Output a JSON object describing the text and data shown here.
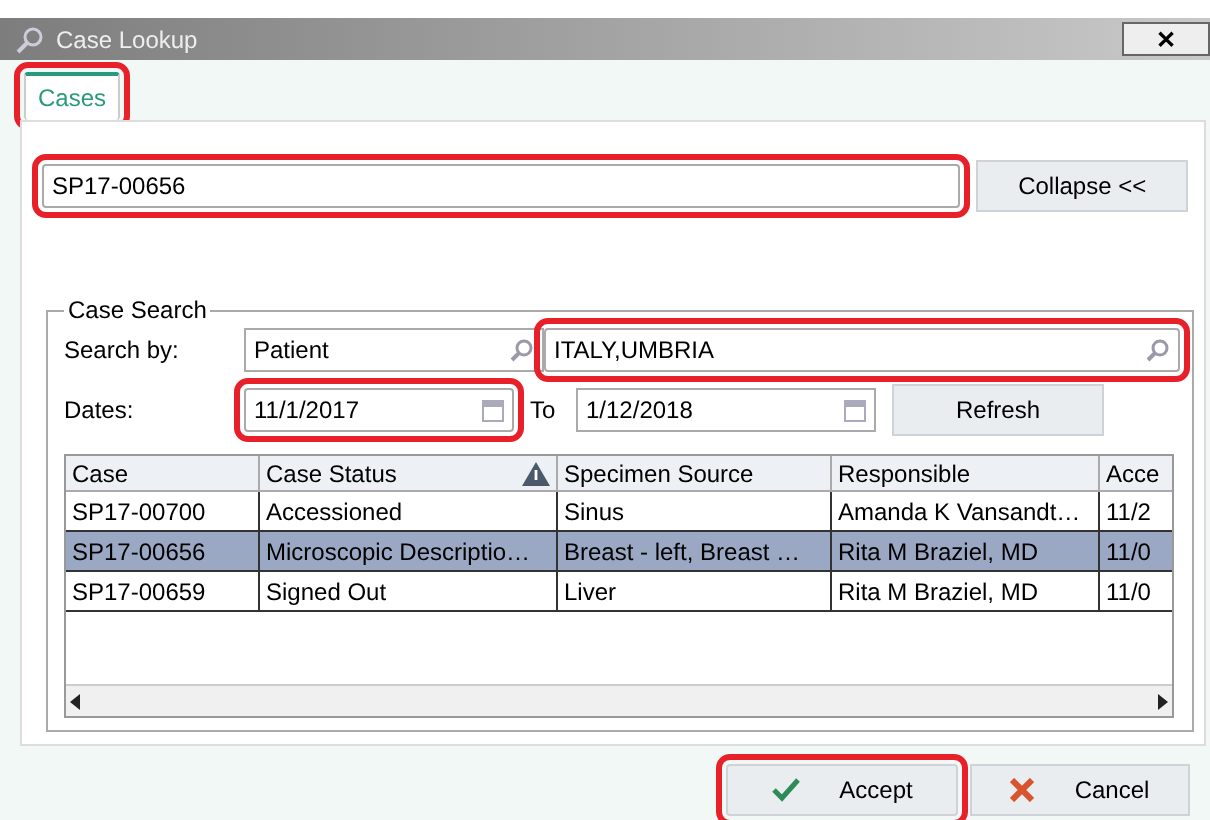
{
  "window": {
    "title": "Case Lookup",
    "close": "✕"
  },
  "tabs": [
    {
      "label": "Cases",
      "selected": true,
      "highlighted": true
    }
  ],
  "case_field": {
    "value": "SP17-00656",
    "highlighted": true
  },
  "collapse_button": {
    "label": "Collapse <<"
  },
  "case_search": {
    "title": "Case Search",
    "search_by": {
      "label": "Search by:",
      "type": "Patient",
      "value": "ITALY,UMBRIA",
      "highlighted": true
    },
    "dates": {
      "label": "Dates:",
      "from": "11/1/2017",
      "from_highlighted": true,
      "to_label": "To",
      "to": "1/12/2018"
    },
    "refresh_button": {
      "label": "Refresh"
    }
  },
  "table": {
    "columns": [
      {
        "label": "Case",
        "sorted": false
      },
      {
        "label": "Case Status",
        "sorted": true
      },
      {
        "label": "Specimen Source",
        "sorted": false
      },
      {
        "label": "Responsible",
        "sorted": false
      },
      {
        "label": "Acce",
        "sorted": false
      }
    ],
    "rows": [
      {
        "selected": false,
        "cells": [
          "SP17-00700",
          "Accessioned",
          "Sinus",
          "Amanda K Vansandt…",
          "11/2"
        ]
      },
      {
        "selected": true,
        "cells": [
          "SP17-00656",
          "Microscopic Descriptio…",
          "Breast - left, Breast …",
          "Rita M Braziel, MD",
          "11/0"
        ]
      },
      {
        "selected": false,
        "cells": [
          "SP17-00659",
          "Signed Out",
          "Liver",
          "Rita M Braziel, MD",
          "11/0"
        ]
      }
    ]
  },
  "buttons": [
    {
      "kind": "accept",
      "label": "Accept",
      "highlighted": true
    },
    {
      "kind": "cancel",
      "label": "Cancel",
      "highlighted": false
    }
  ]
}
